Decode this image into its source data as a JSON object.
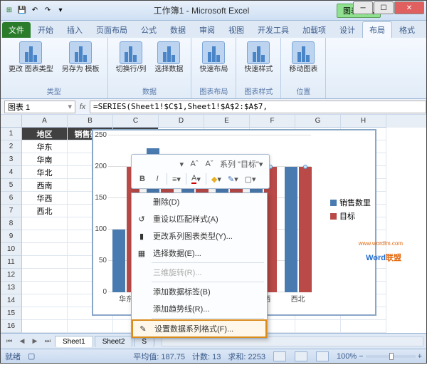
{
  "window": {
    "title": "工作簿1 - Microsoft Excel",
    "context_tab_group": "图表工具"
  },
  "tabs": {
    "file": "文件",
    "list": [
      "开始",
      "插入",
      "页面布局",
      "公式",
      "数据",
      "审阅",
      "视图",
      "开发工具",
      "加载项",
      "设计",
      "布局",
      "格式"
    ],
    "active": "布局"
  },
  "ribbon": {
    "groups": [
      {
        "title": "类型",
        "buttons": [
          {
            "label": "更改\n图表类型"
          },
          {
            "label": "另存为\n模板"
          }
        ]
      },
      {
        "title": "数据",
        "buttons": [
          {
            "label": "切换行/列"
          },
          {
            "label": "选择数据"
          }
        ]
      },
      {
        "title": "图表布局",
        "buttons": [
          {
            "label": "快速布局"
          }
        ]
      },
      {
        "title": "图表样式",
        "buttons": [
          {
            "label": "快速样式"
          }
        ]
      },
      {
        "title": "位置",
        "buttons": [
          {
            "label": "移动图表"
          }
        ]
      }
    ]
  },
  "formula": {
    "name": "图表 1",
    "fx": "fx",
    "value": "=SERIES(Sheet1!$C$1,Sheet1!$A$2:$A$7,"
  },
  "cols": [
    "A",
    "B",
    "C",
    "D",
    "E",
    "F",
    "G",
    "H"
  ],
  "rows": 16,
  "table": {
    "headers": [
      "地区",
      "销售数里",
      "目标"
    ],
    "col1": [
      "华东",
      "华南",
      "华北",
      "西南",
      "华西",
      "西北"
    ]
  },
  "chart_data": {
    "type": "bar",
    "categories": [
      "华东",
      "华南",
      "华北",
      "西南",
      "华西",
      "西北"
    ],
    "series": [
      {
        "name": "销售数里",
        "values": [
          100,
          230,
          175,
          200,
          210,
          200
        ],
        "color": "#4a7bb0"
      },
      {
        "name": "目标",
        "values": [
          200,
          200,
          200,
          200,
          200,
          200
        ],
        "color": "#b94a48"
      }
    ],
    "ylim": [
      0,
      250
    ],
    "yticks": [
      0,
      50,
      100,
      150,
      200,
      250
    ],
    "selected_series": "目标"
  },
  "minitoolbar": {
    "series_label": "系列 \"目标\""
  },
  "contextmenu": [
    {
      "label": "删除(D)",
      "icon": ""
    },
    {
      "label": "重设以匹配样式(A)",
      "icon": "↺"
    },
    {
      "label": "更改系列图表类型(Y)...",
      "icon": "▮"
    },
    {
      "label": "选择数据(E)...",
      "icon": "▦"
    },
    {
      "label": "三维旋转(R)...",
      "disabled": true
    },
    {
      "label": "添加数据标签(B)"
    },
    {
      "label": "添加趋势线(R)..."
    },
    {
      "label": "设置数据系列格式(F)...",
      "icon": "✎",
      "hl": true
    }
  ],
  "sheets": {
    "list": [
      "Sheet1",
      "Sheet2",
      "S"
    ],
    "active": "Sheet1"
  },
  "status": {
    "mode": "就绪",
    "avg_label": "平均值:",
    "avg": "187.75",
    "count_label": "计数:",
    "count": "13",
    "sum_label": "求和:",
    "sum": "2253",
    "zoom": "100%"
  },
  "watermark": {
    "t1": "Word",
    "t2": "联盟",
    "url": "www.wordlm.com"
  }
}
